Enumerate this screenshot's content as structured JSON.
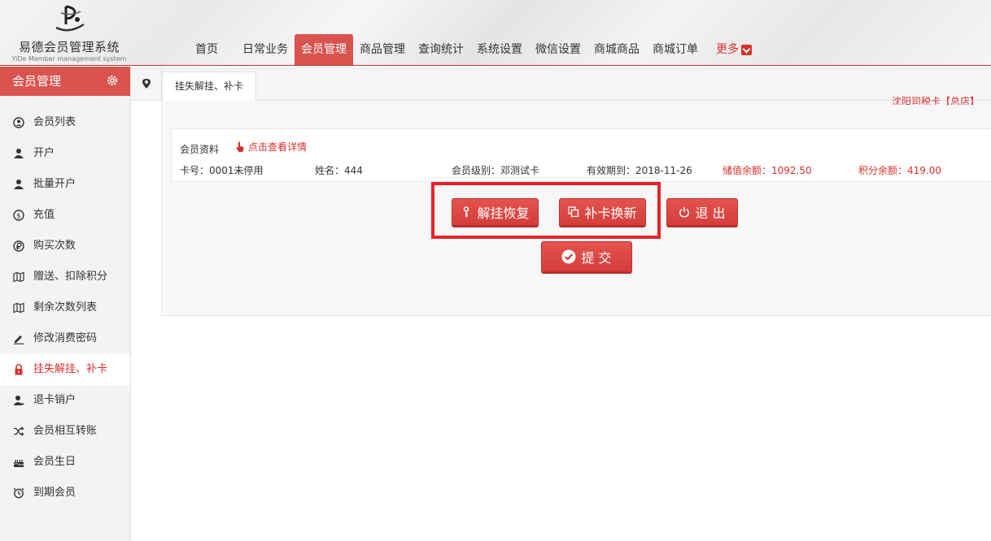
{
  "app": {
    "title": "易德会员管理系统",
    "subtitle": "YiDe Member management system"
  },
  "topnav": [
    {
      "label": "首页",
      "active": false
    },
    {
      "label": "日常业务",
      "active": false
    },
    {
      "label": "会员管理",
      "active": true
    },
    {
      "label": "商品管理",
      "active": false
    },
    {
      "label": "查询统计",
      "active": false
    },
    {
      "label": "系统设置",
      "active": false
    },
    {
      "label": "微信设置",
      "active": false
    },
    {
      "label": "商城商品",
      "active": false
    },
    {
      "label": "商城订单",
      "active": false
    }
  ],
  "topnav_more": "更多",
  "sidebar": {
    "title": "会员管理",
    "items": [
      {
        "label": "会员列表",
        "icon": "user-circle-icon"
      },
      {
        "label": "开户",
        "icon": "user-icon"
      },
      {
        "label": "批量开户",
        "icon": "user-icon"
      },
      {
        "label": "充值",
        "icon": "coin-icon"
      },
      {
        "label": "购买次数",
        "icon": "ruble-icon"
      },
      {
        "label": "赠送、扣除积分",
        "icon": "map-icon"
      },
      {
        "label": "剩余次数列表",
        "icon": "map-icon"
      },
      {
        "label": "修改消费密码",
        "icon": "pencil-icon"
      },
      {
        "label": "挂失解挂、补卡",
        "icon": "lock-icon",
        "active": true
      },
      {
        "label": "退卡销户",
        "icon": "user-minus-icon"
      },
      {
        "label": "会员相互转账",
        "icon": "shuffle-icon"
      },
      {
        "label": "会员生日",
        "icon": "cake-icon"
      },
      {
        "label": "到期会员",
        "icon": "alarm-icon"
      }
    ]
  },
  "tab": {
    "active_label": "挂失解挂、补卡"
  },
  "shop_note": "沈阳司税卡【总店】",
  "member": {
    "section_title": "会员资料",
    "detail_link": "点击查看详情",
    "card_no": "卡号：0001未停用",
    "name": "姓名：444",
    "level": "会员级别：邓测试卡",
    "expiry": "有效期到：2018-11-26",
    "balance": "储值余额：1092.50",
    "points": "积分余额：419.00"
  },
  "buttons": {
    "unlock": "解挂恢复",
    "replace": "补卡换新",
    "exit": "退 出",
    "submit": "提 交"
  },
  "colors": {
    "accent": "#d9534f",
    "highlight": "#e8222a"
  }
}
